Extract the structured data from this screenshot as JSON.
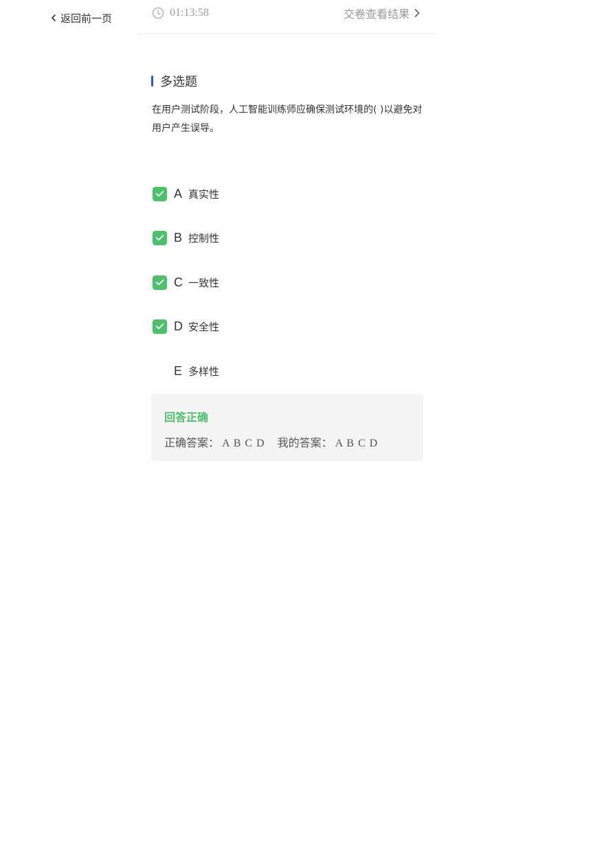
{
  "nav": {
    "back_label": "返回前一页"
  },
  "topbar": {
    "timer": "01:13:58",
    "submit_label": "交卷查看结果"
  },
  "question": {
    "type": "多选题",
    "text": "在用户测试阶段，人工智能训练师应确保测试环境的( )以避免对用户产生误导。",
    "options": [
      {
        "letter": "A",
        "text": "真实性",
        "checked": true
      },
      {
        "letter": "B",
        "text": "控制性",
        "checked": true
      },
      {
        "letter": "C",
        "text": "一致性",
        "checked": true
      },
      {
        "letter": "D",
        "text": "安全性",
        "checked": true
      },
      {
        "letter": "E",
        "text": "多样性",
        "checked": false
      }
    ]
  },
  "result": {
    "status": "回答正确",
    "correct_label": "正确答案：",
    "correct_value": "A B C D",
    "mine_label": "我的答案：",
    "mine_value": "A B C D"
  },
  "colors": {
    "accent_blue": "#2f56e6",
    "success_green": "#4cc16c",
    "muted_gray": "#999999"
  },
  "icons": {
    "back": "chevron-left-icon",
    "timer": "clock-icon",
    "submit": "chevron-right-icon",
    "checked": "checkmark-icon"
  }
}
